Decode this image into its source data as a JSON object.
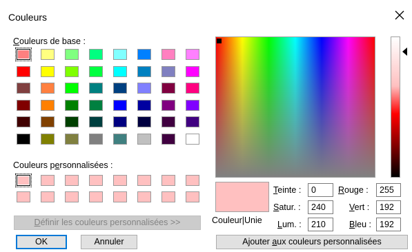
{
  "dialog": {
    "title": "Couleurs"
  },
  "basic": {
    "label": "Couleurs de base :",
    "colors": [
      [
        "#ff8080",
        "#ffff80",
        "#80ff80",
        "#00ff80",
        "#80ffff",
        "#0080ff",
        "#ff80c0",
        "#ff80ff"
      ],
      [
        "#ff0000",
        "#ffff00",
        "#80ff00",
        "#00ff40",
        "#00ffff",
        "#0080c0",
        "#8080c0",
        "#ff00ff"
      ],
      [
        "#804040",
        "#ff8040",
        "#00ff00",
        "#008080",
        "#004080",
        "#8080ff",
        "#800040",
        "#ff0080"
      ],
      [
        "#800000",
        "#ff8000",
        "#008000",
        "#008040",
        "#0000ff",
        "#0000a0",
        "#800080",
        "#8000ff"
      ],
      [
        "#400000",
        "#804000",
        "#004000",
        "#004040",
        "#000080",
        "#000040",
        "#400040",
        "#400080"
      ],
      [
        "#000000",
        "#808000",
        "#808040",
        "#808080",
        "#408080",
        "#c0c0c0",
        "#400040",
        "#ffffff"
      ]
    ]
  },
  "custom": {
    "label": "Couleurs personnalisées :",
    "colors": [
      [
        "#ffc0c0",
        "#ffc0c0",
        "#ffc0c0",
        "#ffc0c0",
        "#ffc0c0",
        "#ffc0c0",
        "#ffc0c0",
        "#ffc0c0"
      ],
      [
        "#ffc0c0",
        "#ffc0c0",
        "#ffc0c0",
        "#ffc0c0",
        "#ffc0c0",
        "#ffc0c0",
        "#ffc0c0",
        "#ffc0c0"
      ]
    ]
  },
  "buttons": {
    "define_custom": "Définir les couleurs personnalisées >>",
    "ok": "OK",
    "cancel": "Annuler",
    "add_custom": "Ajouter aux couleurs personnalisées"
  },
  "preview": {
    "label": "Couleur|Unie",
    "color": "#ffc0c0"
  },
  "fields": {
    "hue_label": "Teinte :",
    "hue_value": "0",
    "sat_label": "Satur. :",
    "sat_value": "240",
    "lum_label": "Lum. :",
    "lum_value": "210",
    "red_label": "Rouge :",
    "red_value": "255",
    "green_label": "Vert :",
    "green_value": "192",
    "blue_label": "Bleu :",
    "blue_value": "192"
  }
}
